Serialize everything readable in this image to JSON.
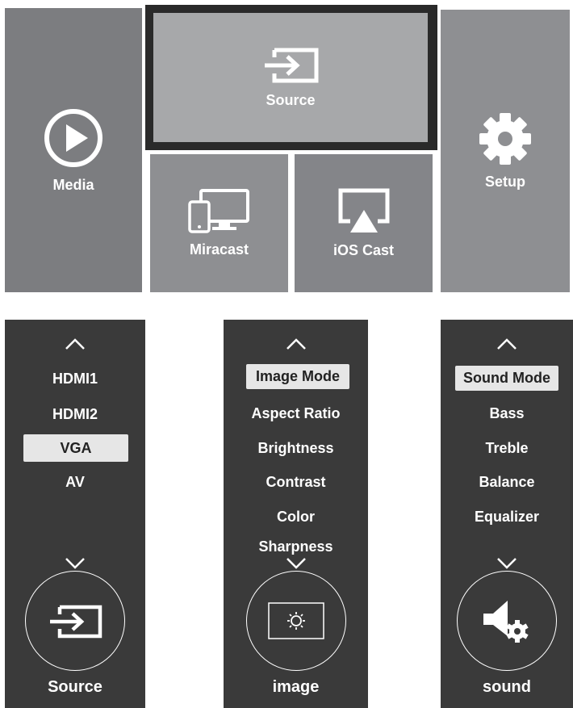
{
  "launcher": {
    "media_label": "Media",
    "source_label": "Source",
    "setup_label": "Setup",
    "miracast_label": "Miracast",
    "ioscast_label": "iOS Cast"
  },
  "source_menu": {
    "items": [
      "HDMI1",
      "HDMI2",
      "VGA",
      "AV"
    ],
    "selected": "VGA",
    "footer_label": "Source"
  },
  "image_menu": {
    "items": [
      "Image Mode",
      "Aspect Ratio",
      "Brightness",
      "Contrast",
      "Color",
      "Sharpness"
    ],
    "selected": "Image Mode",
    "footer_label": "image"
  },
  "sound_menu": {
    "items": [
      "Sound Mode",
      "Bass",
      "Treble",
      "Balance",
      "Equalizer"
    ],
    "selected": "Sound Mode",
    "footer_label": "sound"
  },
  "icons": {
    "media": "play-icon",
    "source": "input-source-icon",
    "setup": "gear-icon",
    "miracast": "devices-icon",
    "ioscast": "airplay-icon",
    "image": "screen-brightness-icon",
    "sound": "speaker-settings-icon",
    "chevron_up": "chevron-up-icon",
    "chevron_down": "chevron-down-icon"
  },
  "colors": {
    "tile_gray": "#8e8f92",
    "source_tile": "#a7a8aa",
    "focus_frame": "#2a2a2a",
    "panel_bg": "#3a3a3a",
    "highlight": "#e6e6e6"
  }
}
